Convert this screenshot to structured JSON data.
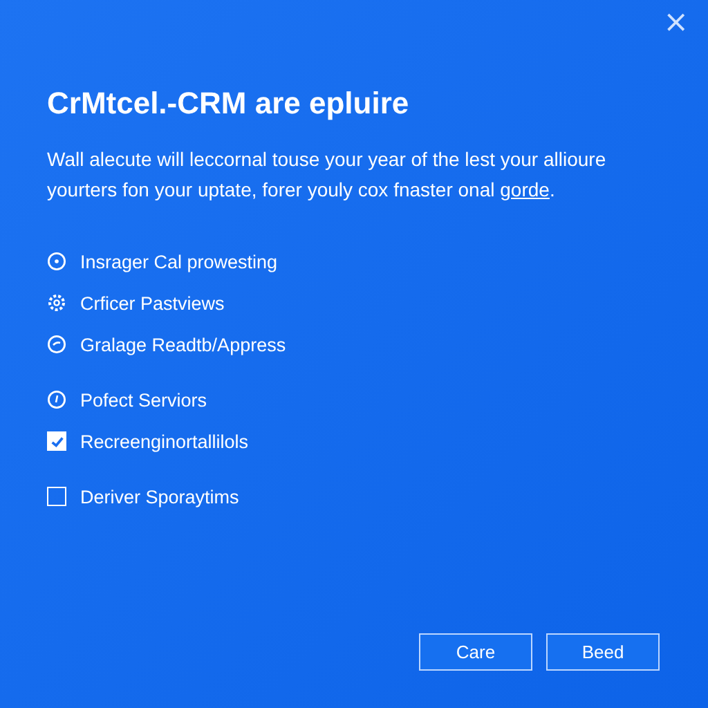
{
  "close_glyph": "×",
  "title": "CrMtcel.-CRM are epluire",
  "description": {
    "text": "Wall alecute will leccornal touse your year of the lest your allioure yourters fon your uptate, forer youly cox fnaster onal",
    "link": "gorde",
    "end": "."
  },
  "options": [
    {
      "kind": "icon",
      "label": "Insrager Cal prowesting"
    },
    {
      "kind": "icon",
      "label": "Crficer Pastviews"
    },
    {
      "kind": "icon",
      "label": "Gralage Readtb/Appress"
    },
    {
      "kind": "icon",
      "label": "Pofect Serviors"
    },
    {
      "kind": "checkbox",
      "label": "Recreenginortallilols",
      "checked": true
    },
    {
      "kind": "checkbox",
      "label": "Deriver Sporaytims",
      "checked": false
    }
  ],
  "buttons": [
    "Care",
    "Beed"
  ]
}
